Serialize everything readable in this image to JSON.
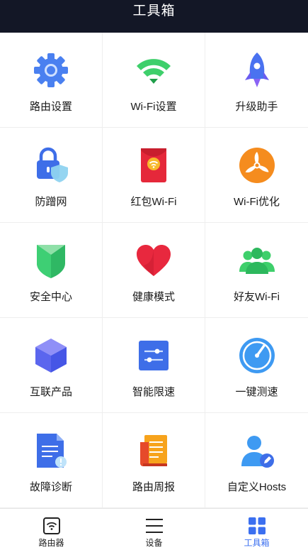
{
  "header": {
    "title": "工具箱"
  },
  "tools": [
    {
      "label": "路由设置",
      "icon": "gear-icon"
    },
    {
      "label": "Wi-Fi设置",
      "icon": "wifi-icon"
    },
    {
      "label": "升级助手",
      "icon": "rocket-icon"
    },
    {
      "label": "防蹭网",
      "icon": "lock-shield-icon"
    },
    {
      "label": "红包Wi-Fi",
      "icon": "red-envelope-icon"
    },
    {
      "label": "Wi-Fi优化",
      "icon": "fan-icon"
    },
    {
      "label": "安全中心",
      "icon": "shield-icon"
    },
    {
      "label": "健康模式",
      "icon": "heart-icon"
    },
    {
      "label": "好友Wi-Fi",
      "icon": "friends-icon"
    },
    {
      "label": "互联产品",
      "icon": "cube-icon"
    },
    {
      "label": "智能限速",
      "icon": "sliders-icon"
    },
    {
      "label": "一键测速",
      "icon": "speedometer-icon"
    },
    {
      "label": "故障诊断",
      "icon": "diagnosis-document-icon"
    },
    {
      "label": "路由周报",
      "icon": "report-icon"
    },
    {
      "label": "自定义Hosts",
      "icon": "user-edit-icon"
    }
  ],
  "tabbar": {
    "items": [
      {
        "label": "路由器",
        "icon": "router-icon",
        "active": false
      },
      {
        "label": "设备",
        "icon": "menu-icon",
        "active": false
      },
      {
        "label": "工具箱",
        "icon": "grid-icon",
        "active": true
      }
    ],
    "active_color": "#3b6ff0"
  },
  "colors": {
    "header_bg": "#131726",
    "accent": "#3b6ff0"
  }
}
